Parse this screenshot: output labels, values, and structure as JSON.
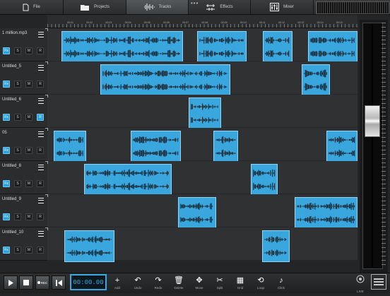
{
  "topbar": {
    "tabs": [
      {
        "label": "File",
        "icon": "file-icon"
      },
      {
        "label": "Projects",
        "icon": "folder-icon"
      },
      {
        "label": "Tracks",
        "icon": "waveform-icon",
        "active": true
      },
      {
        "label": "Effects",
        "icon": "effects-icon"
      },
      {
        "label": "Mixer",
        "icon": "mixer-icon"
      }
    ]
  },
  "ruler": {
    "ticks": [
      "00:01",
      "00:02",
      "00:03",
      "00:04",
      "00:05",
      "00:06",
      "00:07",
      "00:08",
      "00:09",
      "00:10",
      "00:11",
      "00:12",
      "00:13",
      "00:14",
      "00:15"
    ]
  },
  "tracks": [
    {
      "name": "1 million.mp3",
      "buttons": [
        "Fx",
        "S",
        "M",
        "R"
      ],
      "on": [
        0
      ]
    },
    {
      "name": "Untitled_5",
      "buttons": [
        "Fx",
        "S",
        "M",
        "R"
      ],
      "on": [
        0
      ]
    },
    {
      "name": "Untitled_6",
      "buttons": [
        "Fx",
        "S",
        "M",
        "R"
      ],
      "on": [
        0,
        3
      ]
    },
    {
      "name": "05",
      "buttons": [
        "Fx",
        "S",
        "M",
        "R"
      ],
      "on": [
        0
      ]
    },
    {
      "name": "Untitled_8",
      "buttons": [
        "Fx",
        "S",
        "M",
        "R"
      ],
      "on": [
        0
      ]
    },
    {
      "name": "Untitled_9",
      "buttons": [
        "Fx",
        "S",
        "M",
        "R"
      ],
      "on": [
        0
      ]
    },
    {
      "name": "Untitled_10",
      "buttons": [
        "Fx",
        "S",
        "M",
        "R"
      ],
      "on": [
        0
      ]
    }
  ],
  "transport": {
    "timecode": "00:00.00",
    "record_label": "REC"
  },
  "tools": [
    "Add",
    "Undo",
    "Redo",
    "Delete",
    "Move",
    "Split",
    "Grid",
    "Loop",
    "Click"
  ],
  "right": {
    "live_label": "LIVE"
  },
  "colors": {
    "accent": "#3aa6de",
    "background": "#232526"
  }
}
